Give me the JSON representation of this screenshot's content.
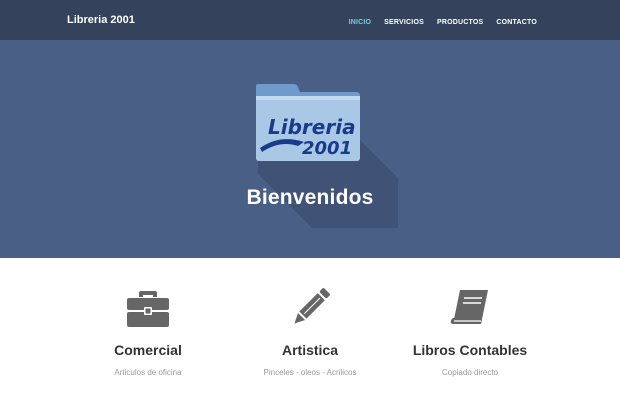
{
  "navbar": {
    "brand": "Libreria 2001",
    "items": [
      {
        "label": "INICIO",
        "active": true
      },
      {
        "label": "SERVICIOS",
        "active": false
      },
      {
        "label": "PRODUCTOS",
        "active": false
      },
      {
        "label": "CONTACTO",
        "active": false
      }
    ]
  },
  "hero": {
    "logo_line1": "Libreria",
    "logo_line2": "2001",
    "title": "Bienvenidos"
  },
  "services": [
    {
      "icon": "briefcase-icon",
      "title": "Comercial",
      "subtitle": "Articulos de oficina"
    },
    {
      "icon": "pencil-icon",
      "title": "Artistica",
      "subtitle": "Pinceles - oleos - Acrilicos"
    },
    {
      "icon": "book-icon",
      "title": "Libros Contables",
      "subtitle": "Copiado directo"
    }
  ],
  "colors": {
    "navbar_bg": "#34425c",
    "hero_bg": "#4a5f86",
    "nav_active": "#78cde3",
    "icon_gray": "#666666",
    "logo_blue": "#1a3a8c"
  }
}
